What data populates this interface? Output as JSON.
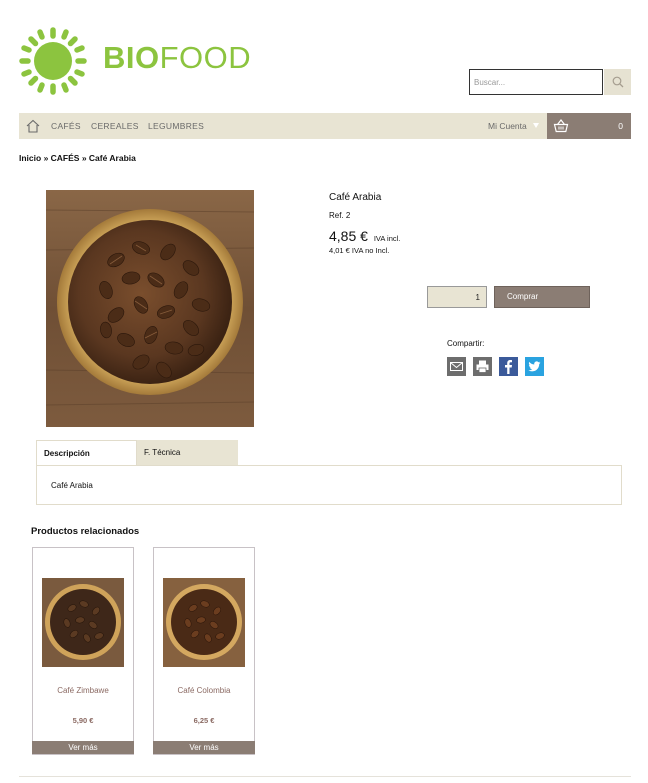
{
  "brand": {
    "logo_bold": "BIO",
    "logo_light": "FOOD",
    "accent_color": "#8cc43f"
  },
  "search": {
    "placeholder": "Buscar...",
    "icon": "search-icon"
  },
  "nav": {
    "items": [
      "CAFÉS",
      "CEREALES",
      "LEGUMBRES"
    ],
    "account_label": "Mi Cuenta",
    "cart_count": "0",
    "bar_color": "#e8e4d3",
    "cart_color": "#8b7d74"
  },
  "breadcrumb": [
    "Inicio",
    "CAFÉS",
    "Café Arabia"
  ],
  "product": {
    "name": "Café Arabia",
    "ref": "Ref. 2",
    "price": "4,85 €",
    "price_vat_label": "IVA incl.",
    "price_no_vat": "4,01 € IVA no Incl.",
    "quantity": "1",
    "buy_label": "Comprar",
    "share_label": "Compartir:",
    "share_icons": [
      "email-icon",
      "print-icon",
      "facebook-icon",
      "twitter-icon"
    ]
  },
  "tabs": {
    "items": [
      "Descripción",
      "F. Técnica"
    ],
    "active": "Descripción",
    "description_text": "Café Arabia"
  },
  "related": {
    "title": "Productos relacionados",
    "items": [
      {
        "name": "Café Zimbawe",
        "price": "5,90 €",
        "button": "Ver más"
      },
      {
        "name": "Café Colombia",
        "price": "6,25 €",
        "button": "Ver más"
      }
    ]
  }
}
